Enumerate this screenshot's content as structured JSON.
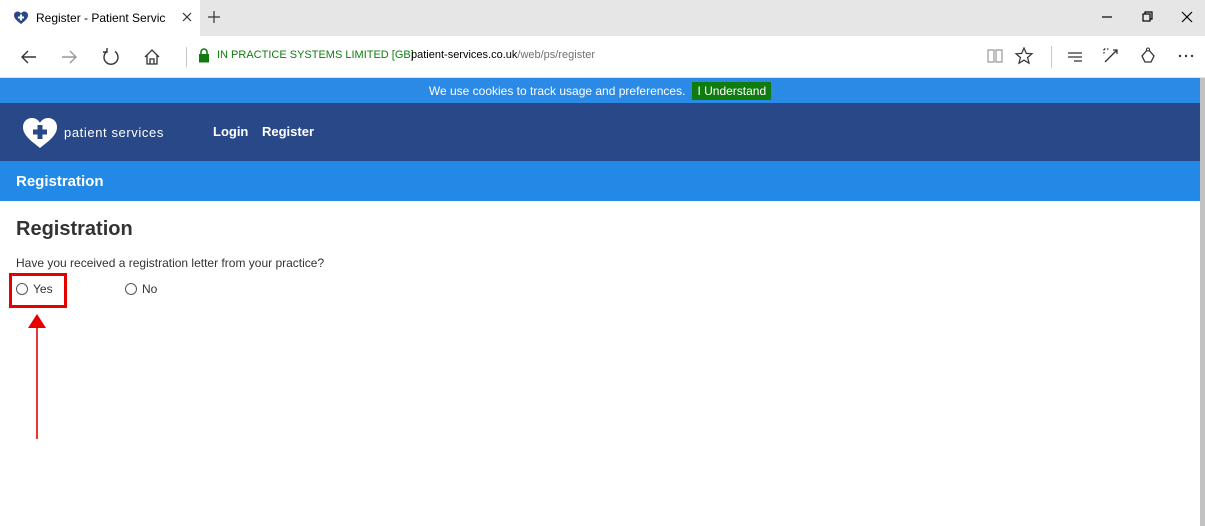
{
  "browser": {
    "tab_title": "Register - Patient Servic",
    "address": {
      "certificate": "IN PRACTICE SYSTEMS LIMITED [GB]",
      "host": "patient-services.co.uk",
      "path": "/web/ps/register"
    }
  },
  "cookie_bar": {
    "message": "We use cookies to track usage and preferences.",
    "button": "I Understand"
  },
  "header": {
    "logo_text": "patient services",
    "nav": [
      "Login",
      "Register"
    ]
  },
  "section": {
    "title": "Registration"
  },
  "main": {
    "heading": "Registration",
    "question": "Have you received a registration letter from your practice?",
    "options": [
      "Yes",
      "No"
    ]
  },
  "colors": {
    "cookie_bar": "#2b8ae6",
    "accept_button": "#107c10",
    "header": "#284887",
    "section_bar": "#2289e6",
    "highlight": "#e60000"
  }
}
